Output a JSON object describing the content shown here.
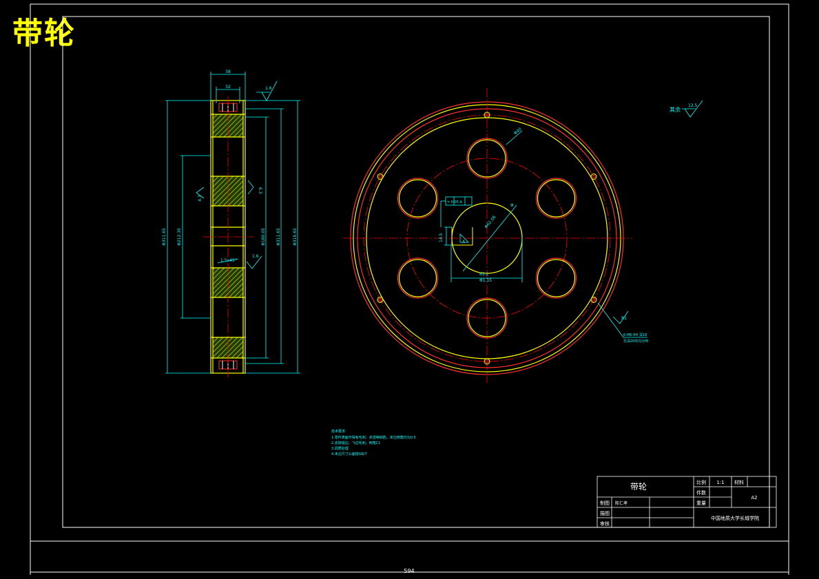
{
  "sheet": {
    "heading": "带轮",
    "bottom_dimension": "594"
  },
  "side_view": {
    "dim_top_outer": "38",
    "dim_top_inner": "32",
    "dim_left_1": "Φ311.65",
    "dim_left_2": "Φ212.35",
    "dim_left_3": "4.3",
    "dim_right_1": "Φ180.05",
    "dim_right_2": "Φ311.65",
    "dim_right_3": "Φ316.65",
    "chamfer": "1.5x45°",
    "roughness_top": "1.6",
    "roughness_mid": "6.3",
    "roughness_low": "1.6"
  },
  "front_view": {
    "hole_dim": "Φ40",
    "bore_dim": "Φ62.06",
    "bore_sym": "Φ",
    "keyway_width": "Φ1.15",
    "keyway_depth": "63.2",
    "tolerance_frame": "= 0.05 A",
    "datum": "A",
    "keyway_height": "14.5",
    "screw_dim": "6-M6-6H 深18",
    "screw_note": "孔深20均匀分布",
    "radius_note": "R1"
  },
  "roughness_global": {
    "label": "其余",
    "value": "12.5"
  },
  "tech_notes": {
    "title": "技术要求",
    "lines": [
      "1.零件表面不得有毛刺、夹渣等缺陷，未注倒角均为0.5",
      "2.去除锐边、飞边毛刺，倒角C1",
      "3.调质处理",
      "4.未注尺寸公差按GB/T"
    ]
  },
  "title_block": {
    "part_name": "带轮",
    "scale_label": "比例",
    "scale_value": "1:1",
    "material_label": "材料",
    "count_label": "件数",
    "weight_label": "重量",
    "sheet_code": "A2",
    "drawn_label": "制图",
    "drawn_by": "陈仁孝",
    "design_label": "描图",
    "check_label": "审核",
    "school": "中国地质大学长城学院"
  },
  "colors": {
    "frame": "#ffffff",
    "outline": "#ffff00",
    "dimension": "#00ffff",
    "centerline": "#ff0000",
    "hatch": "#00c800",
    "heading": "#ffff00"
  }
}
